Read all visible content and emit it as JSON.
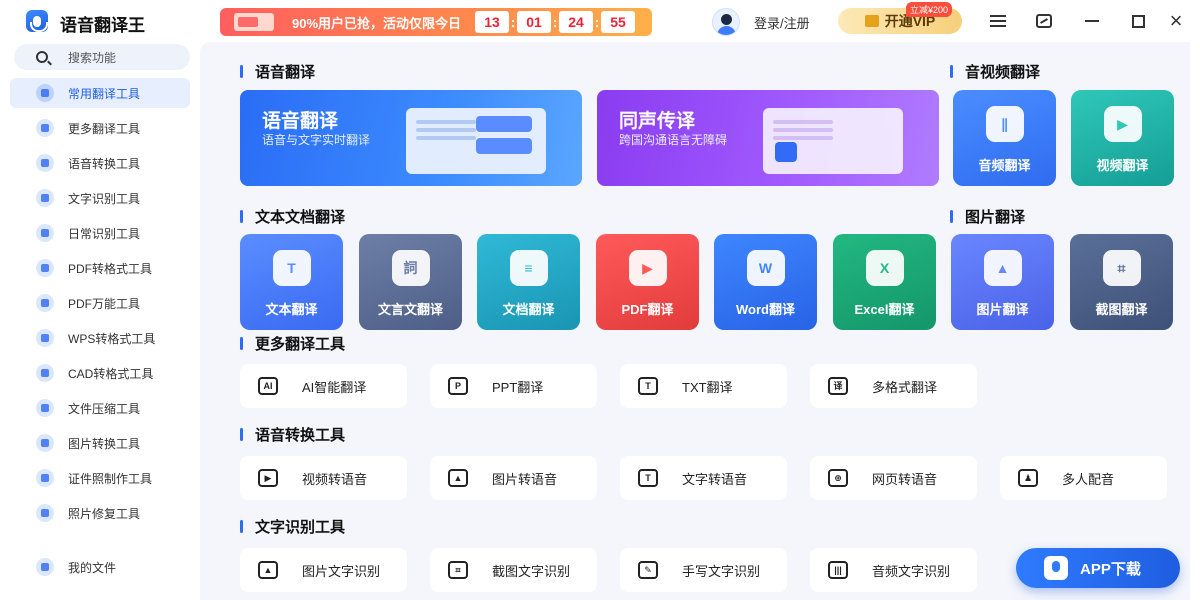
{
  "app": {
    "name": "语音翻译王"
  },
  "promo": {
    "text": "90%用户已抢，活动仅限今日",
    "timer": [
      "13",
      "01",
      "24",
      "55"
    ]
  },
  "header": {
    "login": "登录/注册",
    "vip_label": "开通VIP",
    "vip_tag": "立减¥200"
  },
  "sidebar": {
    "search_placeholder": "搜索功能",
    "items": [
      {
        "label": "常用翻译工具",
        "icon": "translate-icon",
        "active": true
      },
      {
        "label": "更多翻译工具",
        "icon": "more-icon"
      },
      {
        "label": "语音转换工具",
        "icon": "audio-icon"
      },
      {
        "label": "文字识别工具",
        "icon": "text-recognition-icon"
      },
      {
        "label": "日常识别工具",
        "icon": "scan-icon"
      },
      {
        "label": "PDF转格式工具",
        "icon": "pdf-icon"
      },
      {
        "label": "PDF万能工具",
        "icon": "pdf-tools-icon"
      },
      {
        "label": "WPS转格式工具",
        "icon": "wps-icon"
      },
      {
        "label": "CAD转格式工具",
        "icon": "cad-icon"
      },
      {
        "label": "文件压缩工具",
        "icon": "compress-icon"
      },
      {
        "label": "图片转换工具",
        "icon": "image-icon"
      },
      {
        "label": "证件照制作工具",
        "icon": "id-photo-icon"
      },
      {
        "label": "照片修复工具",
        "icon": "photo-repair-icon"
      }
    ],
    "my_files": "我的文件"
  },
  "sections": {
    "voice": "语音翻译",
    "av": "音视频翻译",
    "doc": "文本文档翻译",
    "img": "图片翻译",
    "more": "更多翻译工具",
    "speech": "语音转换工具",
    "ocr": "文字识别工具"
  },
  "banners": [
    {
      "title": "语音翻译",
      "subtitle": "语音与文字实时翻译"
    },
    {
      "title": "同声传译",
      "subtitle": "跨国沟通语言无障碍"
    }
  ],
  "av_tiles": [
    {
      "label": "音频翻译",
      "icon": "audio-wave-icon"
    },
    {
      "label": "视频翻译",
      "icon": "video-icon"
    }
  ],
  "doc_tiles": [
    {
      "label": "文本翻译",
      "glyph": "T"
    },
    {
      "label": "文言文翻译",
      "glyph": "詞"
    },
    {
      "label": "文档翻译",
      "glyph": "≡"
    },
    {
      "label": "PDF翻译",
      "glyph": "▶"
    },
    {
      "label": "Word翻译",
      "glyph": "W"
    },
    {
      "label": "Excel翻译",
      "glyph": "X"
    }
  ],
  "img_tiles": [
    {
      "label": "图片翻译",
      "glyph": "▲"
    },
    {
      "label": "截图翻译",
      "glyph": "⌗"
    }
  ],
  "more_tools": [
    {
      "label": "AI智能翻译",
      "glyph": "AI"
    },
    {
      "label": "PPT翻译",
      "glyph": "P"
    },
    {
      "label": "TXT翻译",
      "glyph": "T"
    },
    {
      "label": "多格式翻译",
      "glyph": "译"
    }
  ],
  "speech_tools": [
    {
      "label": "视频转语音",
      "glyph": "▶"
    },
    {
      "label": "图片转语音",
      "glyph": "▲"
    },
    {
      "label": "文字转语音",
      "glyph": "T"
    },
    {
      "label": "网页转语音",
      "glyph": "⊕"
    },
    {
      "label": "多人配音",
      "glyph": "♟"
    }
  ],
  "ocr_tools": [
    {
      "label": "图片文字识别",
      "glyph": "▲"
    },
    {
      "label": "截图文字识别",
      "glyph": "⌗"
    },
    {
      "label": "手写文字识别",
      "glyph": "✎"
    },
    {
      "label": "音频文字识别",
      "glyph": "|||"
    }
  ],
  "app_download": "APP下载"
}
